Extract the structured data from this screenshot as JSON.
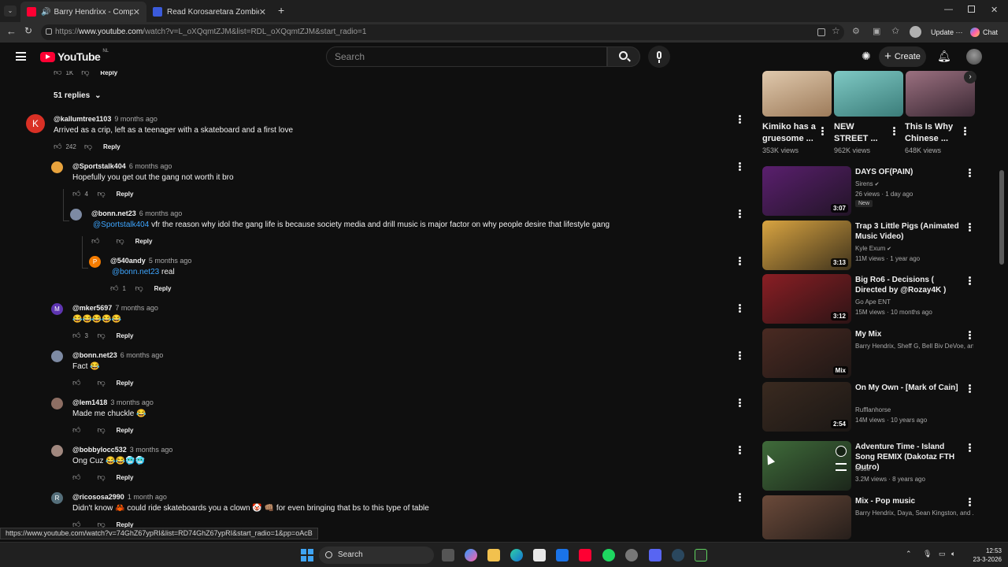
{
  "browser": {
    "tabs": [
      {
        "title": "Barry Hendrixx - Complicated",
        "favicon_color": "#ff0033",
        "active": true
      },
      {
        "title": "Read Korosaretara Zombie ni Natt",
        "favicon_color": "#3b5bdb",
        "active": false
      }
    ],
    "url_prefix": "https://",
    "url_host": "www.youtube.com",
    "url_path": "/watch?v=L_oXQqmtZJM&list=RDL_oXQqmtZJM&start_radio=1",
    "update_label": "Update",
    "chat_label": "Chat"
  },
  "youtube": {
    "logo_text": "YouTube",
    "region": "NL",
    "search_placeholder": "Search",
    "create_label": "Create"
  },
  "comments": {
    "top_reply_count": "1K",
    "replies_toggle": "51 replies",
    "reply_label": "Reply",
    "items": [
      {
        "handle": "@kallumtree1103",
        "ago": "9 months ago",
        "text": "Arrived as a crip, left as a teenager with a skateboard and a first love",
        "likes": "242",
        "avatar_letter": "K",
        "avatar_color": "#d93025"
      },
      {
        "handle": "@Sportstalk404",
        "ago": "6 months ago",
        "text": "Hopefully you get out the gang not worth it bro",
        "likes": "4",
        "avatar_letter": "",
        "avatar_color": "#e8a33d"
      },
      {
        "handle": "@bonn.net23",
        "ago": "6 months ago",
        "mention": "@Sportstalk404",
        "text": "vfr the reason why idol the gang life is because society media and drill music is major factor on why people desire that lifestyle gang",
        "likes": "",
        "avatar_letter": "",
        "avatar_color": "#7d8aa3"
      },
      {
        "handle": "@540andy",
        "ago": "5 months ago",
        "mention": "@bonn.net23",
        "text": "real",
        "likes": "1",
        "avatar_letter": "P",
        "avatar_color": "#f57c00"
      },
      {
        "handle": "@mker5697",
        "ago": "7 months ago",
        "text": "😂😂😂😂😂",
        "likes": "3",
        "avatar_letter": "M",
        "avatar_color": "#5e35b1"
      },
      {
        "handle": "@bonn.net23",
        "ago": "6 months ago",
        "text": "Fact 😂",
        "likes": "",
        "avatar_letter": "",
        "avatar_color": "#7d8aa3"
      },
      {
        "handle": "@lem1418",
        "ago": "3 months ago",
        "text": "Made me chuckle 😂",
        "likes": "",
        "avatar_letter": "",
        "avatar_color": "#8d6e63"
      },
      {
        "handle": "@bobbylocc532",
        "ago": "3 months ago",
        "text": "Ong Cuz 😂😂🥶🥶",
        "likes": "",
        "avatar_letter": "",
        "avatar_color": "#a1887f"
      },
      {
        "handle": "@ricososa2990",
        "ago": "1 month ago",
        "text": "Didn't know 🦀 could ride skateboards you a clown 🤡 👊🏽 for even bringing that bs to this type of table",
        "likes": "",
        "avatar_letter": "R",
        "avatar_color": "#546e7a"
      }
    ]
  },
  "shorts": [
    {
      "title": "Kimiko has a gruesome ...",
      "views": "353K views",
      "color": "#b89a7a"
    },
    {
      "title": "NEW STREET ...",
      "views": "962K views",
      "color": "#5aa3a0"
    },
    {
      "title": "This Is Why Chinese ...",
      "views": "648K views",
      "color": "#6b4e5a"
    }
  ],
  "sidebar": [
    {
      "title": "DAYS OF(PAIN)",
      "channel": "Sirens",
      "verified": true,
      "meta": "26 views · 1 day ago",
      "badge": "New",
      "duration": "3:07",
      "color": "#5a1f6e"
    },
    {
      "title": "Trap 3 Little Pigs (Animated Music Video)",
      "channel": "Kyle Exum",
      "verified": true,
      "meta": "11M views · 1 year ago",
      "badge": "",
      "duration": "3:13",
      "color": "#d9a441"
    },
    {
      "title": "Big Ro6 - Decisions ( Directed by @Rozay4K )",
      "channel": "Go Ape ENT",
      "verified": false,
      "meta": "15M views · 10 months ago",
      "badge": "",
      "duration": "3:12",
      "color": "#8a1e24"
    },
    {
      "title": "My Mix",
      "channel": "Barry Hendrix, Sheff G, Bell Biv DeVoe, an...",
      "verified": false,
      "meta": "",
      "badge": "",
      "duration": "Mix",
      "color": "#4a2a22"
    },
    {
      "title": "On My Own - [Mark of Cain]",
      "channel": "Rufflanhorse",
      "verified": false,
      "meta": "14M views · 10 years ago",
      "badge": "",
      "duration": "2:54",
      "color": "#3a2a20"
    },
    {
      "title": "Adventure Time - Island Song REMIX (Dakotaz FTH Outro)",
      "channel": "Ouse",
      "verified": false,
      "meta": "3.2M views · 8 years ago",
      "badge": "",
      "duration": "",
      "color": "#3f6b3a"
    },
    {
      "title": "Mix - Pop music",
      "channel": "Barry Hendrix, Daya, Sean Kingston, and ...",
      "verified": false,
      "meta": "",
      "badge": "",
      "duration": "",
      "color": "#6b4a3a"
    }
  ],
  "status_url": "https://www.youtube.com/watch?v=74GhZ67ypRI&list=RD74GhZ67ypRI&start_radio=1&pp=oAcB",
  "taskbar": {
    "search_label": "Search",
    "time": "12:53",
    "date": "23-3-2026"
  }
}
